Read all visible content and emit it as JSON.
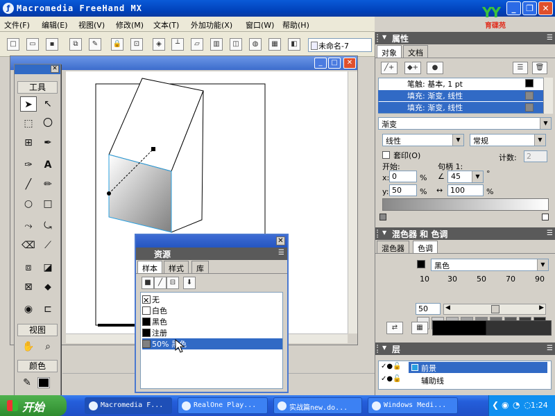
{
  "app": {
    "title": "Macromedia FreeHand MX",
    "logo_text": "育碟苑",
    "logo_mark": "YY"
  },
  "menu": [
    "文件(F)",
    "编辑(E)",
    "视图(V)",
    "修改(M)",
    "文本(T)",
    "外加功能(X)",
    "窗口(W)",
    "帮助(H)"
  ],
  "toolbar": {
    "document_selector": "未命名-7"
  },
  "tools_panel": {
    "tools_label": "工具",
    "view_label": "视图",
    "color_label": "颜色"
  },
  "properties": {
    "title": "属性",
    "tabs": [
      "对象",
      "文档"
    ],
    "rows": [
      {
        "label": "笔触: 基本, 1 pt",
        "selected": false
      },
      {
        "label": "填充: 渐变, 线性",
        "selected": true
      },
      {
        "label": "填充: 渐变, 线性",
        "selected": true
      }
    ],
    "fill_type": "渐变",
    "gradient_type": "线性",
    "gradient_mode": "常规",
    "overprint_label": "套印(O)",
    "count_label": "计数:",
    "count_value": "2",
    "start_label": "开始:",
    "handle_label": "句柄 1:",
    "x_label": "x:",
    "x_value": "0",
    "y_label": "y:",
    "y_value": "50",
    "percent": "%",
    "angle_value": "45",
    "degree": "°",
    "length_value": "100"
  },
  "mixer": {
    "title": "混色器 和 色调",
    "tabs": [
      "混色器",
      "色调"
    ],
    "base_color": "黑色",
    "tint_labels": [
      "10",
      "30",
      "50",
      "70",
      "90"
    ],
    "tint_value": "50",
    "tint_colors": [
      "#e8e8e8",
      "#d0d0d0",
      "#b8b8b8",
      "#a0a0a0",
      "#888888",
      "#707070",
      "#585858",
      "#404040",
      "#282828"
    ]
  },
  "layers": {
    "title": "层",
    "items": [
      {
        "name": "前景",
        "selected": true
      },
      {
        "name": "辅助线",
        "selected": false
      }
    ]
  },
  "assets": {
    "title": "资源",
    "tabs": [
      "样本",
      "样式",
      "库"
    ],
    "items": [
      {
        "name": "无",
        "color": "#ffffff",
        "none": true
      },
      {
        "name": "白色",
        "color": "#ffffff"
      },
      {
        "name": "黑色",
        "color": "#000000"
      },
      {
        "name": "注册",
        "color": "#000000"
      },
      {
        "name": "50% 黑色",
        "color": "#808080",
        "selected": true
      }
    ]
  },
  "taskbar": {
    "start_label": "开始",
    "tasks": [
      "Macromedia F...",
      "RealOne Play...",
      "实战篇new.do...",
      "Windows Medi..."
    ],
    "clock": "1:24"
  }
}
